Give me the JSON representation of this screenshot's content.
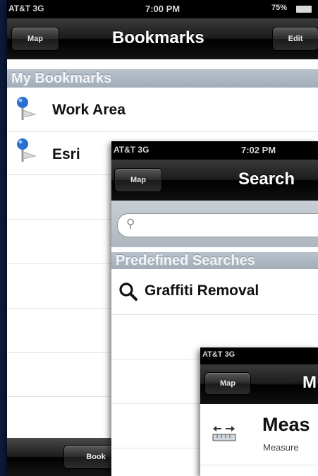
{
  "screen1": {
    "status": {
      "carrier": "AT&T 3G",
      "time": "7:00 PM",
      "battery": "75%"
    },
    "nav": {
      "left_button": "Map",
      "title": "Bookmarks",
      "right_button": "Edit"
    },
    "section": "My Bookmarks",
    "items": [
      {
        "label": "Work Area",
        "icon": "pin-icon"
      },
      {
        "label": "Esri",
        "icon": "pin-icon"
      }
    ],
    "toolbar": {
      "button": "Book"
    }
  },
  "screen2": {
    "status": {
      "carrier": "AT&T 3G",
      "time": "7:02 PM"
    },
    "nav": {
      "left_button": "Map",
      "title": "Search"
    },
    "search": {
      "placeholder": ""
    },
    "section": "Predefined Searches",
    "items": [
      {
        "label": "Graffiti Removal",
        "icon": "magnifier-icon"
      }
    ]
  },
  "screen3": {
    "status": {
      "carrier": "AT&T 3G"
    },
    "nav": {
      "left_button": "Map",
      "title": "M"
    },
    "items": [
      {
        "title": "Meas",
        "subtitle": "Measure",
        "icon": "measure-ruler-icon"
      }
    ]
  },
  "colors": {
    "background": "#0d1b3d",
    "section_header": "#a9b4bf",
    "navbar": "#1a1a1a"
  }
}
